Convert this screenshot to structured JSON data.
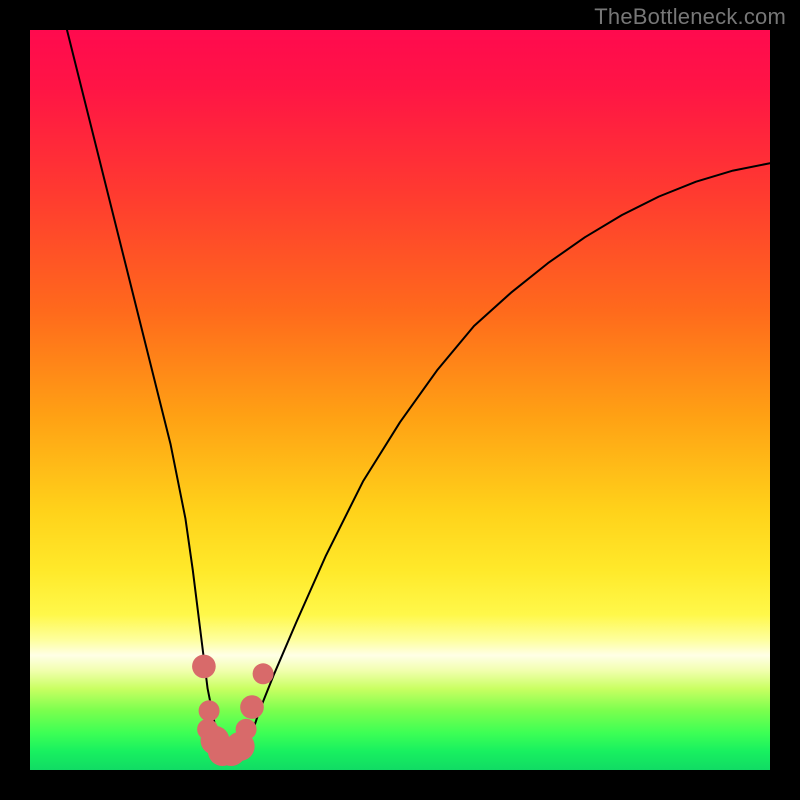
{
  "watermark": "TheBottleneck.com",
  "chart_data": {
    "type": "line",
    "title": "",
    "xlabel": "",
    "ylabel": "",
    "xlim": [
      0,
      100
    ],
    "ylim": [
      0,
      100
    ],
    "grid": false,
    "legend": false,
    "series": [
      {
        "name": "bottleneck-v-curve",
        "x": [
          5,
          7,
          9,
          11,
          13,
          15,
          17,
          19,
          21,
          22,
          23,
          24,
          25,
          26,
          27,
          28,
          29,
          30,
          31,
          33,
          36,
          40,
          45,
          50,
          55,
          60,
          65,
          70,
          75,
          80,
          85,
          90,
          95,
          100
        ],
        "y": [
          100,
          92,
          84,
          76,
          68,
          60,
          52,
          44,
          34,
          27,
          19,
          11,
          6,
          3,
          2,
          2,
          3,
          5,
          8,
          13,
          20,
          29,
          39,
          47,
          54,
          60,
          64.5,
          68.5,
          72,
          75,
          77.5,
          79.5,
          81,
          82
        ]
      }
    ],
    "markers": [
      {
        "x": 23.5,
        "y": 14,
        "r": 1.4
      },
      {
        "x": 24.2,
        "y": 8,
        "r": 1.2
      },
      {
        "x": 24.0,
        "y": 5.5,
        "r": 1.2
      },
      {
        "x": 25.0,
        "y": 4,
        "r": 1.8
      },
      {
        "x": 26.0,
        "y": 2.5,
        "r": 1.8
      },
      {
        "x": 27.2,
        "y": 2.5,
        "r": 1.8
      },
      {
        "x": 28.4,
        "y": 3.2,
        "r": 1.8
      },
      {
        "x": 29.2,
        "y": 5.5,
        "r": 1.2
      },
      {
        "x": 30.0,
        "y": 8.5,
        "r": 1.4
      },
      {
        "x": 31.5,
        "y": 13,
        "r": 1.2
      }
    ]
  }
}
